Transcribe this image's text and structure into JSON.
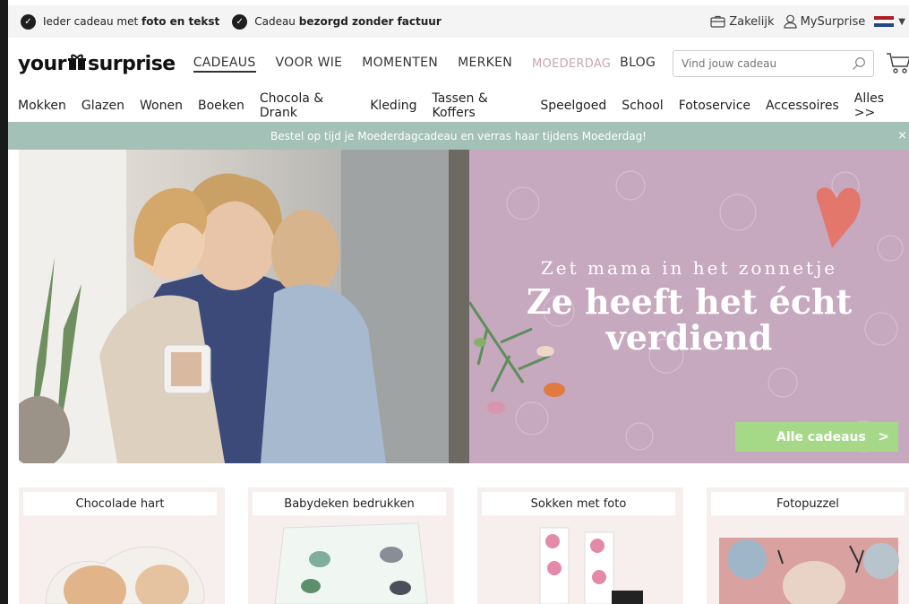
{
  "topbar": {
    "usp1_pre": "Ieder cadeau met ",
    "usp1_bold": "foto en tekst",
    "usp2_pre": "Cadeau ",
    "usp2_bold": "bezorgd zonder factuur",
    "zakelijk": "Zakelijk",
    "mysurprise": "MySurprise"
  },
  "header": {
    "logo_left": "your",
    "logo_right": "surprise",
    "nav": [
      "CADEAUS",
      "VOOR WIE",
      "MOMENTEN",
      "MERKEN"
    ],
    "moederdag": "MOEDERDAG",
    "blog": "BLOG",
    "search_placeholder": "Vind jouw cadeau"
  },
  "categories": [
    "Mokken",
    "Glazen",
    "Wonen",
    "Boeken",
    "Chocola & Drank",
    "Kleding",
    "Tassen & Koffers",
    "Speelgoed",
    "School",
    "Fotoservice",
    "Accessoires",
    "Alles >>"
  ],
  "promo": {
    "text": "Bestel op tijd je Moederdagcadeau en verras haar tijdens Moederdag!",
    "close": "×"
  },
  "hero": {
    "subtitle": "Zet mama in het zonnetje",
    "title_line1": "Ze heeft het écht",
    "title_line2": "verdiend",
    "cta": "Alle cadeaus",
    "cta_arrow": ">"
  },
  "cards": [
    "Chocolade hart",
    "Babydeken bedrukken",
    "Sokken met foto",
    "Fotopuzzel"
  ],
  "colors": {
    "promo_bg": "#a3c1b6",
    "hero_pink": "#c6a8bf",
    "cta_green": "#a6d987",
    "moederdag": "#c7a6b5"
  }
}
